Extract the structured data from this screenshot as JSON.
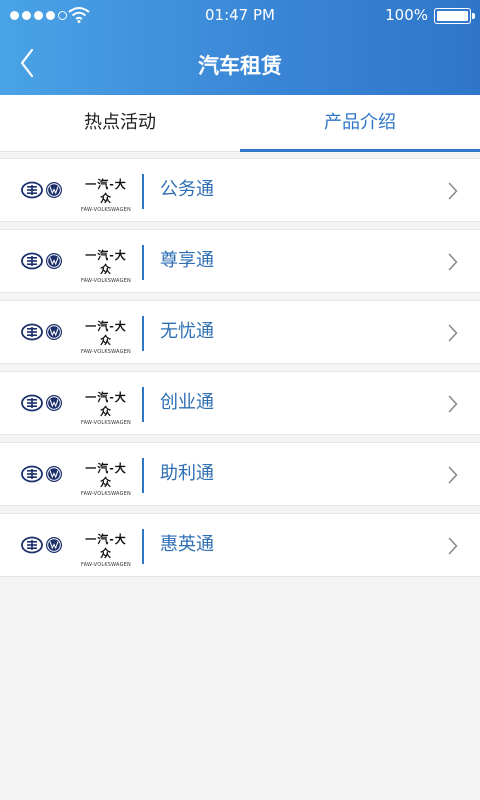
{
  "status": {
    "time": "01:47 PM",
    "battery": "100%"
  },
  "header": {
    "title": "汽车租赁",
    "back_icon": "chevron-left-icon"
  },
  "tabs": [
    {
      "label": "热点活动",
      "active": false
    },
    {
      "label": "产品介绍",
      "active": true
    }
  ],
  "brand": {
    "cn": "一汽-大众",
    "en": "FAW-VOLKSWAGEN"
  },
  "products": [
    {
      "name": "公务通"
    },
    {
      "name": "尊享通"
    },
    {
      "name": "无忧通"
    },
    {
      "name": "创业通"
    },
    {
      "name": "助利通"
    },
    {
      "name": "惠英通"
    }
  ],
  "colors": {
    "accent": "#2f76c8",
    "header_start": "#4aa3e6",
    "header_end": "#2f76c8",
    "product_text": "#2f6fb4"
  }
}
